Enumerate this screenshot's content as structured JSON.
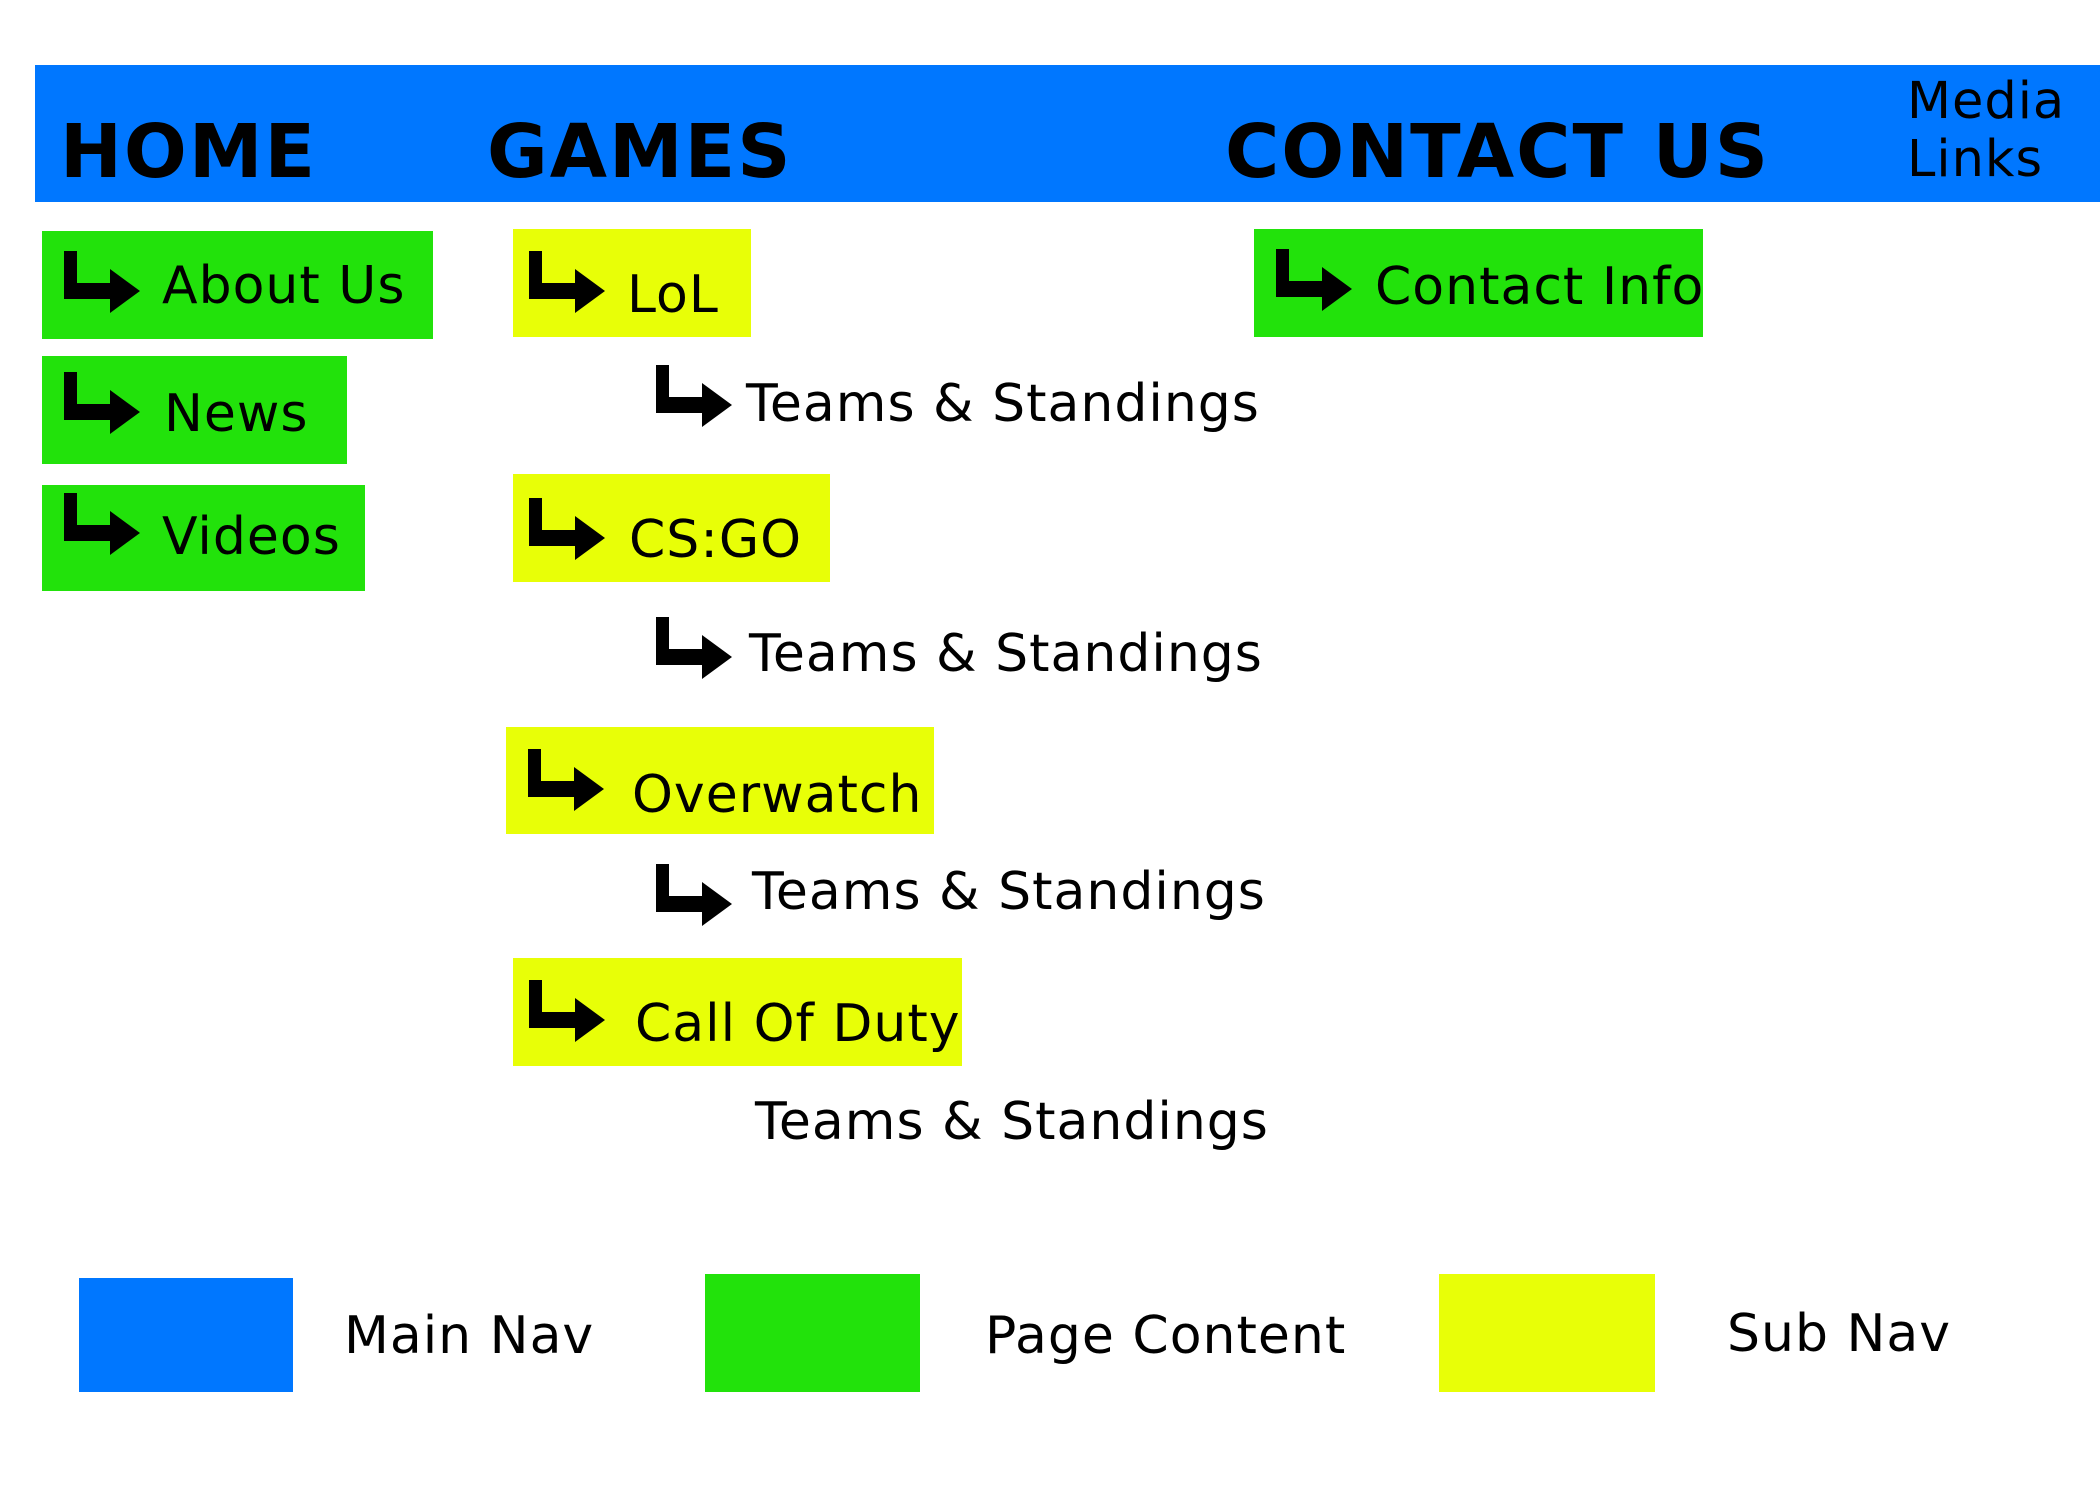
{
  "colors": {
    "main_nav": "#0077ff",
    "page_content": "#22e20b",
    "sub_nav": "#e8ff07"
  },
  "main_nav": {
    "home": "HOME",
    "games": "GAMES",
    "contact_us": "CONTACT US",
    "media_line1": "Media",
    "media_line2": "Links"
  },
  "home_pages": [
    {
      "label": "About Us",
      "icon": "arrow-right-turn-icon"
    },
    {
      "label": "News",
      "icon": "arrow-right-turn-icon"
    },
    {
      "label": "Videos",
      "icon": "arrow-right-turn-icon"
    }
  ],
  "games": [
    {
      "label": "LoL",
      "sub": "Teams & Standings"
    },
    {
      "label": "CS:GO",
      "sub": "Teams & Standings"
    },
    {
      "label": "Overwatch",
      "sub": "Teams & Standings"
    },
    {
      "label": "Call Of Duty",
      "sub": "Teams & Standings"
    }
  ],
  "contact_pages": [
    {
      "label": "Contact Info",
      "icon": "arrow-right-turn-icon"
    }
  ],
  "legend": [
    {
      "label": "Main Nav",
      "color": "#0077ff"
    },
    {
      "label": "Page Content",
      "color": "#22e20b"
    },
    {
      "label": "Sub Nav",
      "color": "#e8ff07"
    }
  ]
}
